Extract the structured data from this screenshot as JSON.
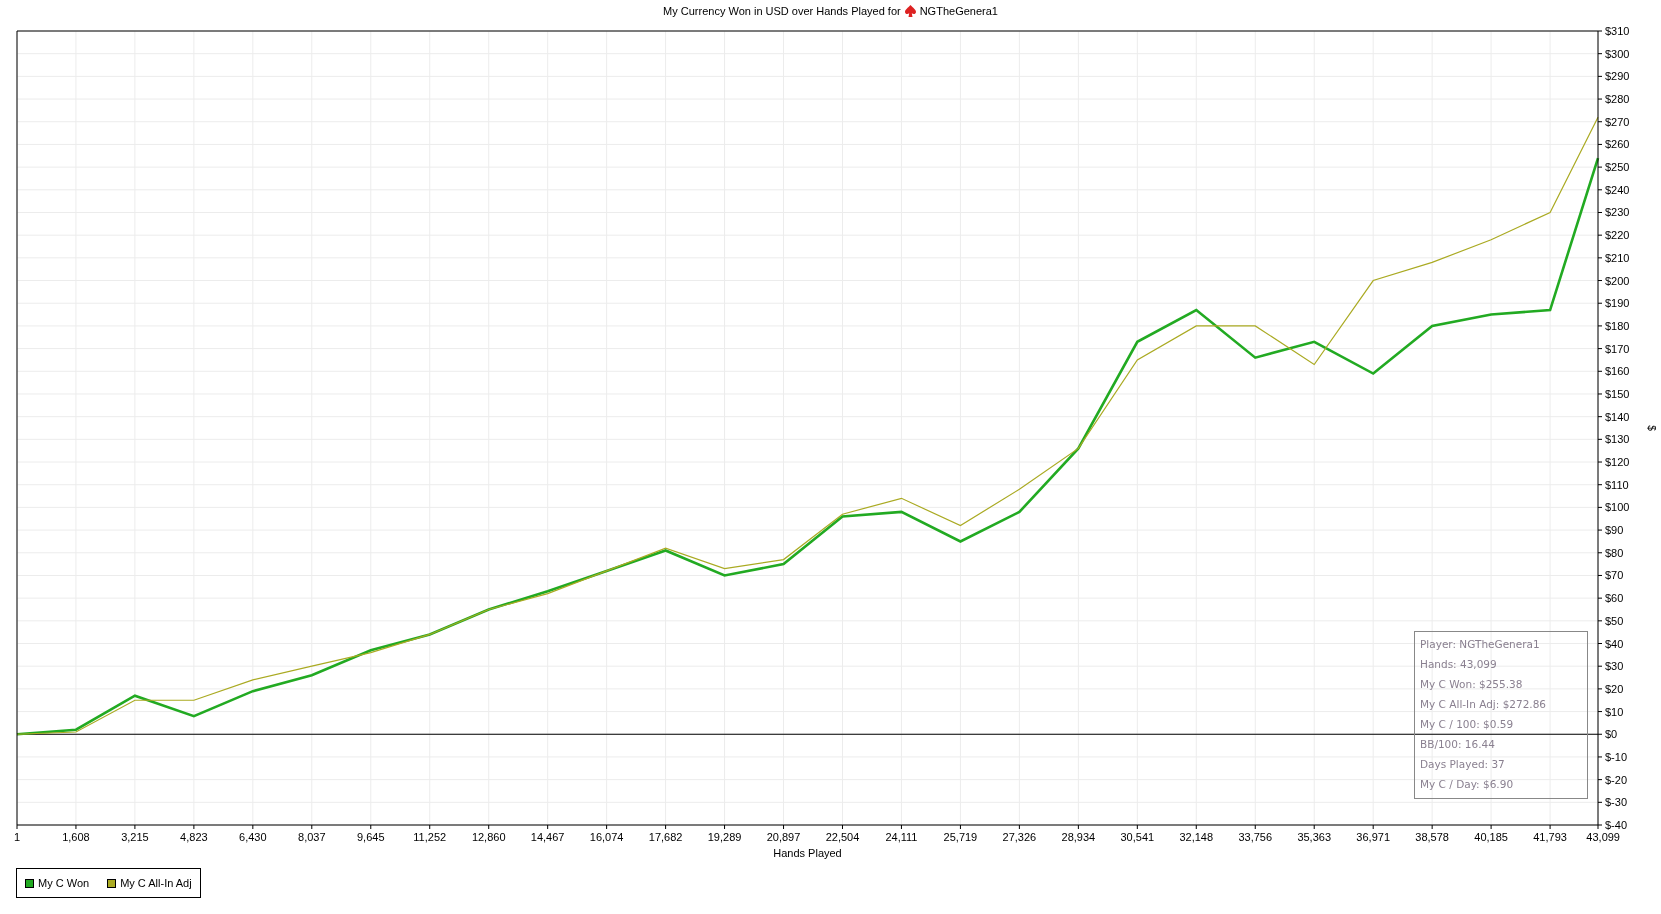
{
  "title": {
    "text": "My Currency Won in USD over Hands Played for",
    "player": "NGTheGenera1"
  },
  "chart": {
    "chart_data": {
      "type": "line",
      "grid": true,
      "xlabel": "Hands Played",
      "ylabel": "$",
      "xlim": [
        1,
        43099
      ],
      "ylim": [
        -40,
        310
      ],
      "x": [
        1,
        1608,
        3215,
        4823,
        6430,
        8037,
        9645,
        11252,
        12860,
        14467,
        16074,
        17682,
        19289,
        20897,
        22504,
        24111,
        25719,
        27326,
        28934,
        30541,
        32148,
        33756,
        35363,
        36971,
        38578,
        40185,
        41793,
        43099
      ],
      "series": [
        {
          "name": "My C Won",
          "color": "#22aa22",
          "values": [
            0,
            2,
            17,
            8,
            19,
            26,
            37,
            44,
            55,
            63,
            72,
            81,
            70,
            75,
            96,
            98,
            85,
            98,
            126,
            173,
            187,
            166,
            173,
            159,
            180,
            185,
            187,
            254
          ]
        },
        {
          "name": "My C All-In Adj",
          "color": "#aaaa22",
          "values": [
            0,
            1,
            15,
            15,
            24,
            30,
            36,
            44,
            55,
            62,
            72,
            82,
            73,
            77,
            97,
            104,
            92,
            108,
            126,
            165,
            180,
            180,
            163,
            200,
            208,
            218,
            230,
            272
          ]
        }
      ],
      "xticks": [
        {
          "value": 1,
          "label": "1"
        },
        {
          "value": 1608,
          "label": "1,608"
        },
        {
          "value": 3215,
          "label": "3,215"
        },
        {
          "value": 4823,
          "label": "4,823"
        },
        {
          "value": 6430,
          "label": "6,430"
        },
        {
          "value": 8037,
          "label": "8,037"
        },
        {
          "value": 9645,
          "label": "9,645"
        },
        {
          "value": 11252,
          "label": "11,252"
        },
        {
          "value": 12860,
          "label": "12,860"
        },
        {
          "value": 14467,
          "label": "14,467"
        },
        {
          "value": 16074,
          "label": "16,074"
        },
        {
          "value": 17682,
          "label": "17,682"
        },
        {
          "value": 19289,
          "label": "19,289"
        },
        {
          "value": 20897,
          "label": "20,897"
        },
        {
          "value": 22504,
          "label": "22,504"
        },
        {
          "value": 24111,
          "label": "24,111"
        },
        {
          "value": 25719,
          "label": "25,719"
        },
        {
          "value": 27326,
          "label": "27,326"
        },
        {
          "value": 28934,
          "label": "28,934"
        },
        {
          "value": 30541,
          "label": "30,541"
        },
        {
          "value": 32148,
          "label": "32,148"
        },
        {
          "value": 33756,
          "label": "33,756"
        },
        {
          "value": 35363,
          "label": "35,363"
        },
        {
          "value": 36971,
          "label": "36,971"
        },
        {
          "value": 38578,
          "label": "38,578"
        },
        {
          "value": 40185,
          "label": "40,185"
        },
        {
          "value": 41793,
          "label": "41,793"
        },
        {
          "value": 43099,
          "label": "43,099"
        }
      ],
      "yticks": [
        {
          "value": 310,
          "label": "$310"
        },
        {
          "value": 300,
          "label": "$300"
        },
        {
          "value": 290,
          "label": "$290"
        },
        {
          "value": 280,
          "label": "$280"
        },
        {
          "value": 270,
          "label": "$270"
        },
        {
          "value": 260,
          "label": "$260"
        },
        {
          "value": 250,
          "label": "$250"
        },
        {
          "value": 240,
          "label": "$240"
        },
        {
          "value": 230,
          "label": "$230"
        },
        {
          "value": 220,
          "label": "$220"
        },
        {
          "value": 210,
          "label": "$210"
        },
        {
          "value": 200,
          "label": "$200"
        },
        {
          "value": 190,
          "label": "$190"
        },
        {
          "value": 180,
          "label": "$180"
        },
        {
          "value": 170,
          "label": "$170"
        },
        {
          "value": 160,
          "label": "$160"
        },
        {
          "value": 150,
          "label": "$150"
        },
        {
          "value": 140,
          "label": "$140"
        },
        {
          "value": 130,
          "label": "$130"
        },
        {
          "value": 120,
          "label": "$120"
        },
        {
          "value": 110,
          "label": "$110"
        },
        {
          "value": 100,
          "label": "$100"
        },
        {
          "value": 90,
          "label": "$90"
        },
        {
          "value": 80,
          "label": "$80"
        },
        {
          "value": 70,
          "label": "$70"
        },
        {
          "value": 60,
          "label": "$60"
        },
        {
          "value": 50,
          "label": "$50"
        },
        {
          "value": 40,
          "label": "$40"
        },
        {
          "value": 30,
          "label": "$30"
        },
        {
          "value": 20,
          "label": "$20"
        },
        {
          "value": 10,
          "label": "$10"
        },
        {
          "value": 0,
          "label": "$0"
        },
        {
          "value": -10,
          "label": "$-10"
        },
        {
          "value": -20,
          "label": "$-20"
        },
        {
          "value": -30,
          "label": "$-30"
        },
        {
          "value": -40,
          "label": "$-40"
        }
      ]
    }
  },
  "stats": [
    "Player: NGTheGenera1",
    "Hands: 43,099",
    "My C Won: $255.38",
    "My C All-In Adj: $272.86",
    "My C / 100: $0.59",
    "BB/100: 16.44",
    "Days Played: 37",
    "My C / Day: $6.90"
  ],
  "legend": {
    "kind": "series"
  }
}
